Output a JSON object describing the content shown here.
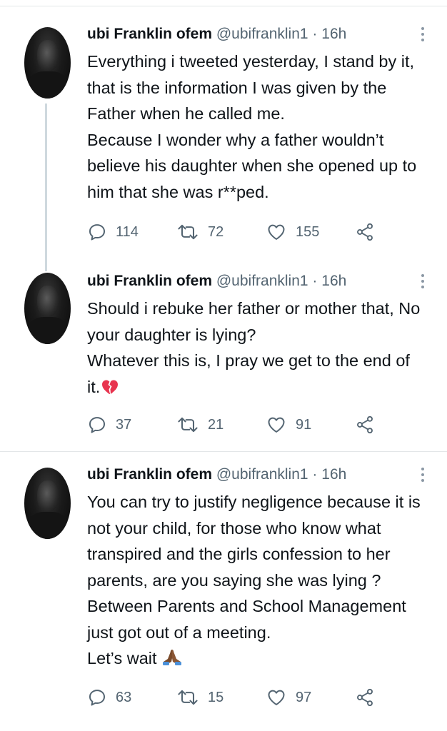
{
  "tweets": [
    {
      "author_name": "ubi Franklin ofem",
      "handle": "@ubifranklin1",
      "separator": "·",
      "time": "16h",
      "lines": [
        "Everything i tweeted yesterday, I stand by it,",
        "that is the information I was given by the",
        "Father when he called me.",
        "Because I wonder why a father wouldn’t",
        "believe his daughter when she opened up to",
        "him that she was r**ped."
      ],
      "emoji": "",
      "replies": "114",
      "retweets": "72",
      "likes": "155"
    },
    {
      "author_name": "ubi Franklin ofem",
      "handle": "@ubifranklin1",
      "separator": "·",
      "time": "16h",
      "lines": [
        "Should i rebuke her father or mother that, No",
        "your daughter is lying?",
        "Whatever this is, I pray we get to the end of",
        "it."
      ],
      "emoji": "broken-heart",
      "replies": "37",
      "retweets": "21",
      "likes": "91"
    },
    {
      "author_name": "ubi Franklin ofem",
      "handle": "@ubifranklin1",
      "separator": "·",
      "time": "16h",
      "lines": [
        "You can try to justify negligence because it is",
        "not your child, for those who know what",
        "transpired and the girls confession to her",
        "parents, are you saying she was lying ?",
        "Between Parents and School Management",
        "just got out of a meeting.",
        "Let’s wait"
      ],
      "emoji": "folded-hands",
      "replies": "63",
      "retweets": "15",
      "likes": "97"
    }
  ],
  "colors": {
    "text": "#0f1419",
    "secondary": "#536471",
    "thread_line": "#cfd9de",
    "divider": "#e3e6e8",
    "heart_emoji": "#e8344f",
    "hands_emoji": "#7a4a2a"
  },
  "icons": [
    "reply-icon",
    "retweet-icon",
    "like-icon",
    "share-icon",
    "more-icon"
  ]
}
